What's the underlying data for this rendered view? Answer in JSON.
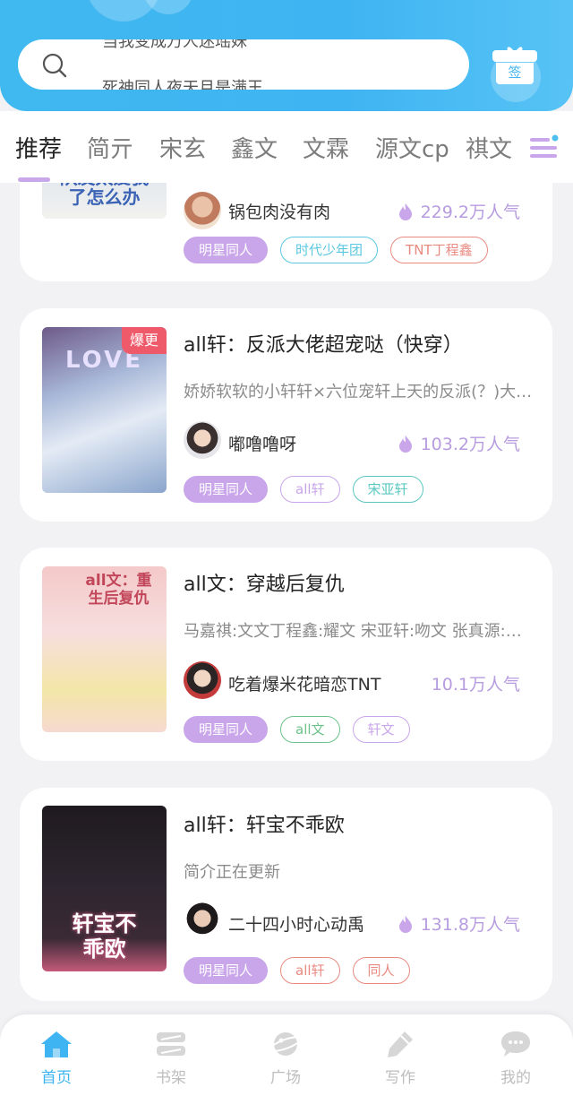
{
  "search": {
    "scroll_line_1": "当我变成万人迷瑶妹",
    "scroll_line_2": "死神同人夜天月是满王"
  },
  "checkin_label": "签",
  "tabs": [
    "推荐",
    "简亓",
    "宋玄",
    "鑫文",
    "文霖",
    "源文cp",
    "祺文"
  ],
  "active_tab": 0,
  "cards": [
    {
      "cover_text": "队友太爱我了怎么办",
      "author": "锅包肉没有肉",
      "popularity": "229.2万人气",
      "show_flame": true,
      "tags": [
        {
          "label": "明星同人",
          "style": "filled",
          "color": "#c9a5ea"
        },
        {
          "label": "时代少年团",
          "style": "outline",
          "color": "#5bc7e0"
        },
        {
          "label": "TNT丁程鑫",
          "style": "outline",
          "color": "#e98a82"
        }
      ]
    },
    {
      "badge": "爆更",
      "cover_text": "LOVE",
      "title": "all轩：反派大佬超宠哒（快穿）",
      "desc": "娇娇软软的小轩轩×六位宠轩上天的反派(？)大佬…",
      "author": "嘟噜噜呀",
      "popularity": "103.2万人气",
      "show_flame": true,
      "tags": [
        {
          "label": "明星同人",
          "style": "filled",
          "color": "#c9a5ea"
        },
        {
          "label": "all轩",
          "style": "outline",
          "color": "#c9a5ea"
        },
        {
          "label": "宋亚轩",
          "style": "outline",
          "color": "#5bc7c0"
        }
      ]
    },
    {
      "cover_text": "all文：重生后复仇",
      "title": "all文：穿越后复仇",
      "desc": "马嘉祺:文文丁程鑫:耀文 宋亚轩:吻文 张真源:文文…",
      "author": "吃着爆米花暗恋TNT",
      "popularity": "10.1万人气",
      "show_flame": false,
      "tags": [
        {
          "label": "明星同人",
          "style": "filled",
          "color": "#c9a5ea"
        },
        {
          "label": "all文",
          "style": "outline",
          "color": "#6cc28a"
        },
        {
          "label": "轩文",
          "style": "outline",
          "color": "#c9a5ea"
        }
      ]
    },
    {
      "cover_text": "轩宝不乖欧",
      "title": "all轩：轩宝不乖欧",
      "desc": "简介正在更新",
      "author": "二十四小时心动禹",
      "popularity": "131.8万人气",
      "show_flame": true,
      "tags": [
        {
          "label": "明星同人",
          "style": "filled",
          "color": "#c9a5ea"
        },
        {
          "label": "all轩",
          "style": "outline",
          "color": "#e98a82"
        },
        {
          "label": "同人",
          "style": "outline",
          "color": "#e98a82"
        }
      ]
    }
  ],
  "bottom_nav": [
    {
      "label": "首页",
      "icon": "home-icon",
      "active": true
    },
    {
      "label": "书架",
      "icon": "bookshelf-icon",
      "active": false
    },
    {
      "label": "广场",
      "icon": "planet-icon",
      "active": false
    },
    {
      "label": "写作",
      "icon": "pen-icon",
      "active": false
    },
    {
      "label": "我的",
      "icon": "chat-bubble-icon",
      "active": false
    }
  ],
  "colors": {
    "brand_blue": "#3fb4f2",
    "accent_purple": "#c9a5ea",
    "popularity": "#b79ce0"
  }
}
